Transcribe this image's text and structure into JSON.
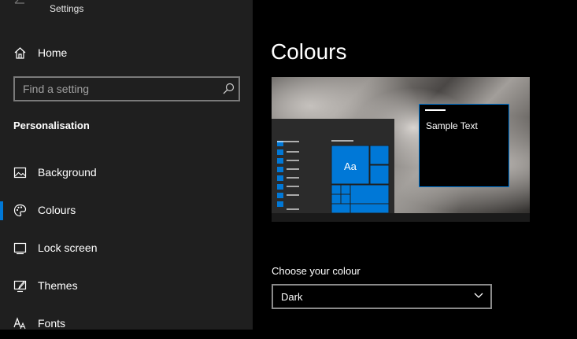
{
  "app": {
    "title": "Settings"
  },
  "sidebar": {
    "home_label": "Home",
    "search": {
      "placeholder": "Find a setting",
      "value": ""
    },
    "section_title": "Personalisation",
    "items": [
      {
        "label": "Background",
        "icon": "picture-icon"
      },
      {
        "label": "Colours",
        "icon": "palette-icon",
        "active": true
      },
      {
        "label": "Lock screen",
        "icon": "lock-screen-icon"
      },
      {
        "label": "Themes",
        "icon": "themes-icon"
      },
      {
        "label": "Fonts",
        "icon": "fonts-icon"
      }
    ]
  },
  "main": {
    "title": "Colours",
    "preview": {
      "tile_text": "Aa",
      "sample_text": "Sample Text"
    },
    "choose_colour": {
      "label": "Choose your colour",
      "value": "Dark"
    }
  },
  "colors": {
    "accent": "#0078d7",
    "sidebar_bg": "#1f1f1f",
    "main_bg": "#000000"
  }
}
